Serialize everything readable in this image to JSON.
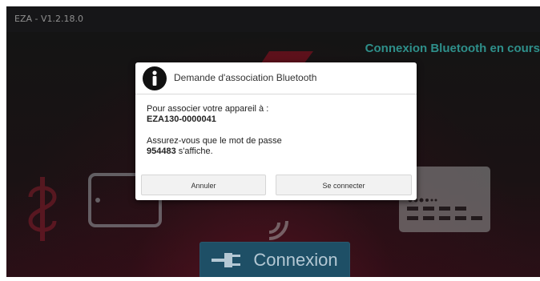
{
  "app": {
    "title": "EZA - V1.2.18.0"
  },
  "status": {
    "text": "Connexion Bluetooth en cours"
  },
  "main": {
    "connect_label": "Connexion"
  },
  "dialog": {
    "title": "Demande d'association Bluetooth",
    "line1": "Pour associer votre appareil à :",
    "device": "EZA130-0000041",
    "line2": "Assurez-vous que le mot de passe",
    "passkey": "954483",
    "line3_suffix": " s'affiche.",
    "cancel_label": "Annuler",
    "connect_label": "Se connecter"
  },
  "icons": [
    "info-icon",
    "plug-icon",
    "tablet-icon",
    "bluetooth-waves-icon",
    "card-terminal-icon",
    "logo-icon"
  ],
  "colors": {
    "status_teal": "#2e8f8a",
    "connect_button": "#1e4f66",
    "titlebar": "#161618"
  }
}
